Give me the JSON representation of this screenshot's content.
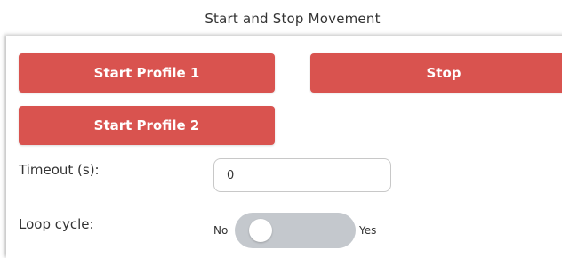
{
  "section": {
    "title": "Start and Stop Movement"
  },
  "buttons": {
    "start_profile_1": "Start Profile 1",
    "stop": "Stop",
    "start_profile_2": "Start Profile 2"
  },
  "timeout": {
    "label": "Timeout (s):",
    "value": "0"
  },
  "loop_cycle": {
    "label": "Loop cycle:",
    "off_label": "No",
    "on_label": "Yes",
    "enabled": false
  },
  "colors": {
    "button_red": "#d9534f",
    "toggle_off": "#c4c8cd"
  }
}
